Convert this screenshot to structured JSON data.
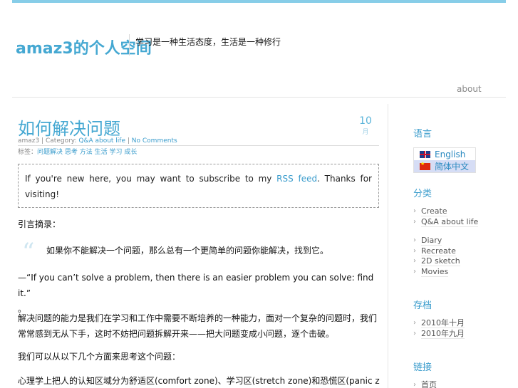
{
  "header": {
    "site_title": "amaz3的个人空间",
    "tagline": "学习是一种生活态度，生活是一种修行"
  },
  "nav": {
    "about": "about"
  },
  "post": {
    "title": "如何解决问题",
    "date_day": "10",
    "date_month": "月",
    "meta": {
      "author": "amaz3",
      "category_prefix": " | Category: ",
      "category": "Q&A about life",
      "sep": " | ",
      "comments": "No Comments"
    },
    "tags_label": "标签：",
    "tags": "问题解决 思考 方法 生活 学习 成长",
    "notice": {
      "before": "If you're new here, you may want to subscribe to my ",
      "link": "RSS feed",
      "after": ". Thanks for visiting!"
    },
    "p1": "引言摘录：",
    "quote": "如果你不能解决一个问题，那么总有一个更简单的问题你能解决，找到它。",
    "p2": "—“If you can’t solve a problem, then there is an easier problem you can solve: find it.”",
    "p2_tail": "。",
    "p3": "解决问题的能力是我们在学习和工作中需要不断培养的一种能力，面对一个复杂的问题时，我们常常感到无从下手，这时不妨把问题拆解开来——把大问题变成小问题，逐个击破。",
    "p4": "我们可以从以下几个方面来思考这个问题：",
    "p5": "心理学上把人的认知区域分为舒适区(comfort zone)、学习区(stretch zone)和恐慌区(panic zone)，在学习区中挑战自己最有效。"
  },
  "sidebar": {
    "language_heading": "语言",
    "languages": [
      {
        "label": "English",
        "flag": "uk-flag"
      },
      {
        "label": "简体中文",
        "flag": "cn-flag"
      }
    ],
    "categories_heading": "分类",
    "categories": [
      "Create",
      "Q&A about life",
      "Diary",
      "Recreate",
      "2D sketch",
      "Movies"
    ],
    "archives_heading": "存档",
    "archives": [
      "2010年十月",
      "2010年九月"
    ],
    "links_heading": "链接",
    "links": [
      "首页"
    ]
  },
  "colors": {
    "accent": "#45a8d2",
    "top_bar": "#87cde8",
    "active_language_bg": "#d6ddf5"
  }
}
